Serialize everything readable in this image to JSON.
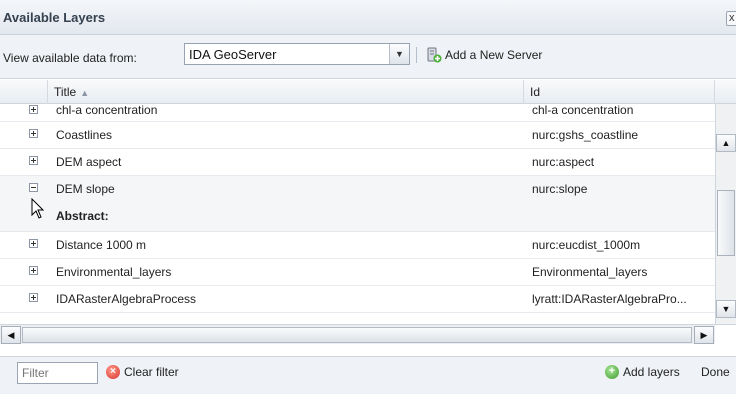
{
  "window": {
    "title": "Available Layers",
    "close_label": "x"
  },
  "toolbar": {
    "view_label": "View available data from:",
    "server_select": "IDA GeoServer",
    "add_server_label": "Add a New Server"
  },
  "grid": {
    "columns": [
      "Title",
      "Id"
    ],
    "rows": [
      {
        "title": "chl-a concentration",
        "id": "chl-a concentration",
        "expanded": false
      },
      {
        "title": "Coastlines",
        "id": "nurc:gshs_coastline",
        "expanded": false
      },
      {
        "title": "DEM aspect",
        "id": "nurc:aspect",
        "expanded": false
      },
      {
        "title": "DEM slope",
        "id": "nurc:slope",
        "expanded": true,
        "detail_label": "Abstract:"
      },
      {
        "title": "Distance 1000 m",
        "id": "nurc:eucdist_1000m",
        "expanded": false
      },
      {
        "title": "Environmental_layers",
        "id": "Environmental_layers",
        "expanded": false
      },
      {
        "title": "IDARasterAlgebraProcess",
        "id": "lyratt:IDARasterAlgebraPro...",
        "expanded": false
      }
    ]
  },
  "bottom": {
    "filter_placeholder": "Filter",
    "clear_filter_label": "Clear filter",
    "add_layers_label": "Add layers",
    "done_label": "Done"
  },
  "icons": {
    "server": "server-icon",
    "clear": "red-x-icon",
    "add": "green-plus-icon"
  }
}
